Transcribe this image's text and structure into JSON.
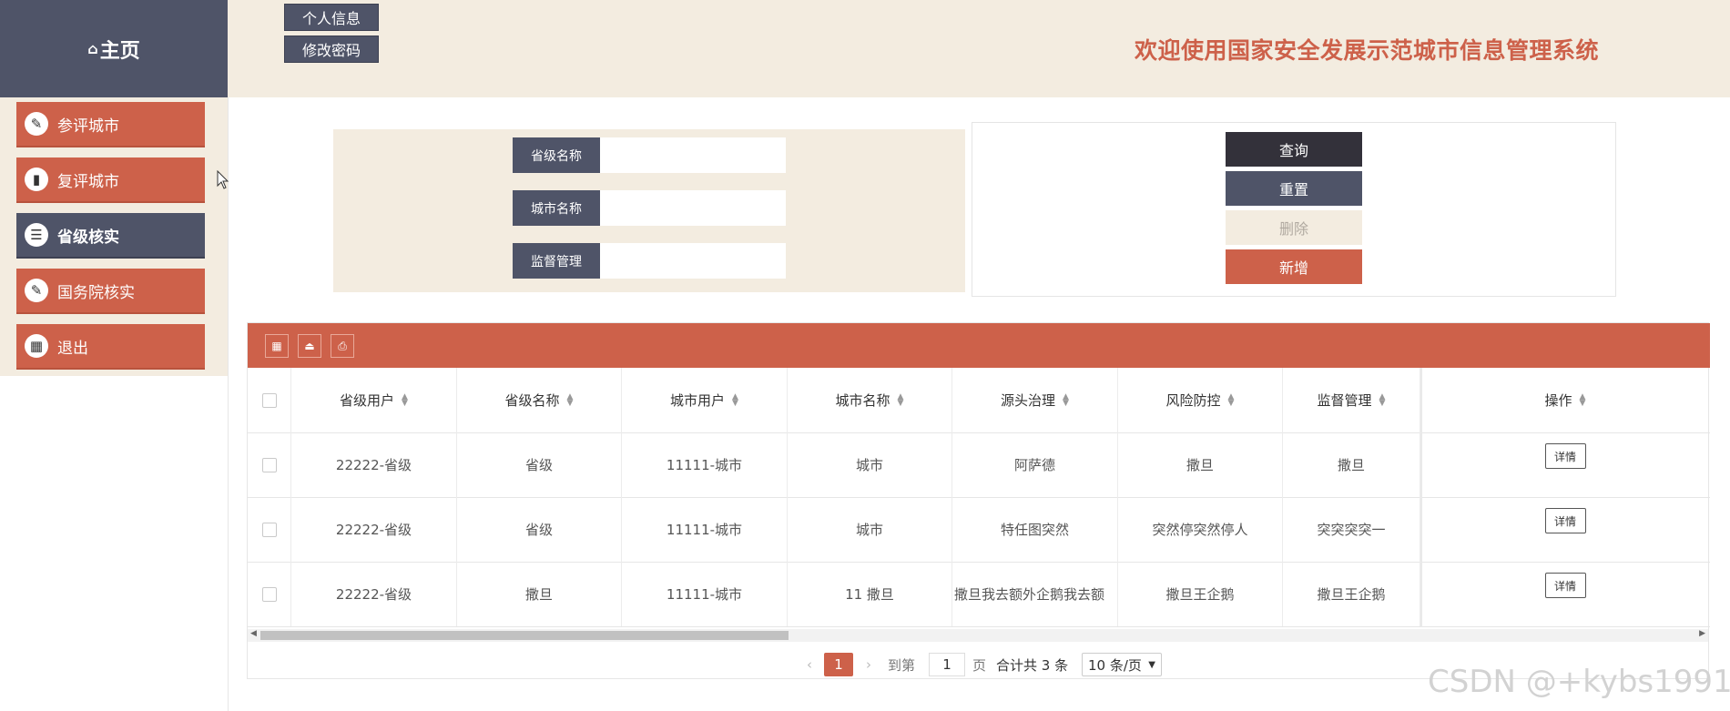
{
  "header": {
    "brand": "主页",
    "buttons": [
      "个人信息",
      "修改密码"
    ],
    "welcome": "欢迎使用国家安全发展示范城市信息管理系统"
  },
  "sidebar": {
    "items": [
      {
        "label": "参评城市",
        "icon": "edit-icon",
        "active": false
      },
      {
        "label": "复评城市",
        "icon": "chart-icon",
        "active": false
      },
      {
        "label": "省级核实",
        "icon": "clipboard-icon",
        "active": true
      },
      {
        "label": "国务院核实",
        "icon": "edit-icon",
        "active": false
      },
      {
        "label": "退出",
        "icon": "calendar-icon",
        "active": false
      }
    ]
  },
  "search": {
    "fields": [
      {
        "label": "省级名称",
        "value": ""
      },
      {
        "label": "城市名称",
        "value": ""
      },
      {
        "label": "监督管理",
        "value": ""
      }
    ],
    "buttons": {
      "query": "查询",
      "reset": "重置",
      "delete": "删除",
      "add": "新增"
    }
  },
  "table": {
    "columns": [
      "省级用户",
      "省级名称",
      "城市用户",
      "城市名称",
      "源头治理",
      "风险防控",
      "监督管理",
      "操作"
    ],
    "rows": [
      [
        "22222-省级",
        "省级",
        "11111-城市",
        "城市",
        "阿萨德",
        "撒旦",
        "撒旦",
        "详情"
      ],
      [
        "22222-省级",
        "省级",
        "11111-城市",
        "城市",
        "特任图突然",
        "突然停突然停人",
        "突突突突一",
        "详情"
      ],
      [
        "22222-省级",
        "撒旦",
        "11111-城市",
        "11 撒旦",
        "撒旦我去额外企鹅我去额",
        "撒旦王企鹅",
        "撒旦王企鹅",
        "详情"
      ]
    ]
  },
  "pager": {
    "current": "1",
    "goto_prefix": "到第",
    "goto_value": "1",
    "goto_suffix": "页",
    "total": "合计共 3 条",
    "page_size": "10 条/页"
  },
  "watermark": "CSDN @+kybs1991",
  "colors": {
    "primary": "#cd614a",
    "dark": "#4f5468",
    "panel": "#f3ece0"
  }
}
